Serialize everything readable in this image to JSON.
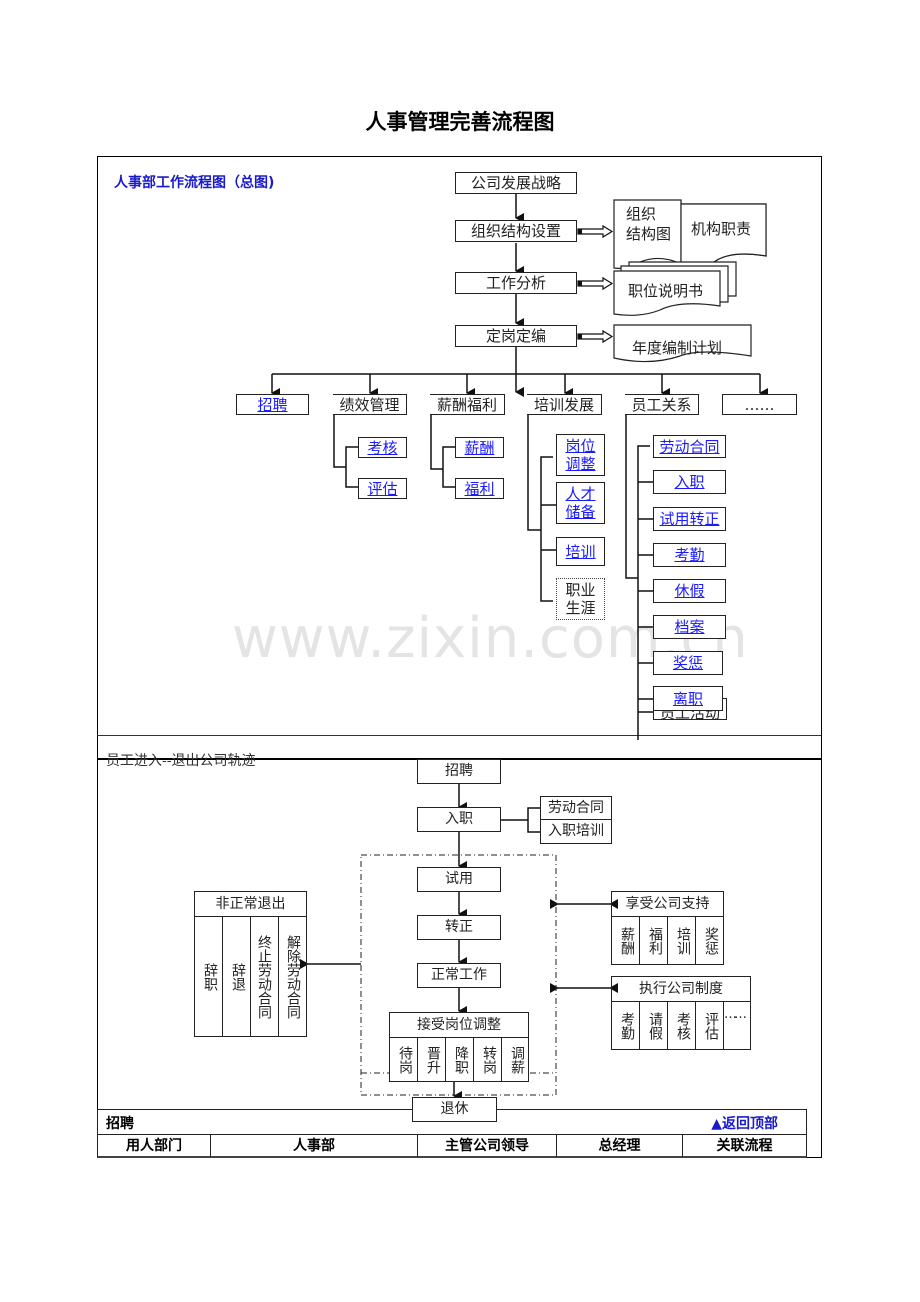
{
  "title": "人事管理完善流程图",
  "section1": {
    "subtitle": "人事部工作流程图（总图)",
    "main_flow": [
      "公司发展战略",
      "组织结构设置",
      "工作分析",
      "定岗定编"
    ],
    "outputs": {
      "org_chart": "组织\n结构图",
      "org_duties": "机构职责",
      "job_desc": "职位说明书",
      "annual_plan": "年度编制计划"
    },
    "branches": [
      {
        "label": "招聘",
        "link": true
      },
      {
        "label": "绩效管理",
        "link": false,
        "children": [
          "考核",
          "评估"
        ]
      },
      {
        "label": "薪酬福利",
        "link": false,
        "children": [
          "薪酬",
          "福利"
        ]
      },
      {
        "label": "培训发展",
        "link": false,
        "children": [
          "岗位\n调整",
          "人才\n储备",
          "培训",
          "职业\n生涯"
        ]
      },
      {
        "label": "员工关系",
        "link": false,
        "children": [
          "劳动合同",
          "入职",
          "试用转正",
          "考勤",
          "休假",
          "档案",
          "奖惩",
          "离职",
          "员工活动"
        ]
      },
      {
        "label": "……",
        "link": false
      }
    ],
    "watermark": "www.zixin.com.cn"
  },
  "section2": {
    "subtitle": "员工进入--退出公司轨迹",
    "flow": [
      "招聘",
      "入职",
      "试用",
      "转正",
      "正常工作"
    ],
    "onboarding": [
      "劳动合同",
      "入职培训"
    ],
    "abnormal_exit": {
      "header": "非正常退出",
      "items": [
        "辞职",
        "辞退",
        "终止劳动合同",
        "解除劳动合同"
      ]
    },
    "position_adjust": {
      "header": "接受岗位调整",
      "items": [
        "待岗",
        "晋升",
        "降职",
        "转岗",
        "调薪"
      ]
    },
    "company_support": {
      "header": "享受公司支持",
      "items": [
        "薪酬",
        "福利",
        "培训",
        "奖惩"
      ]
    },
    "company_rules": {
      "header": "执行公司制度",
      "items": [
        "考勤",
        "请假",
        "考核",
        "评估",
        "……"
      ]
    },
    "retire": "退休"
  },
  "footer": {
    "section_label": "招聘",
    "back_to_top": "▲返回顶部",
    "columns": [
      "用人部门",
      "人事部",
      "主管公司领导",
      "总经理",
      "关联流程"
    ]
  }
}
